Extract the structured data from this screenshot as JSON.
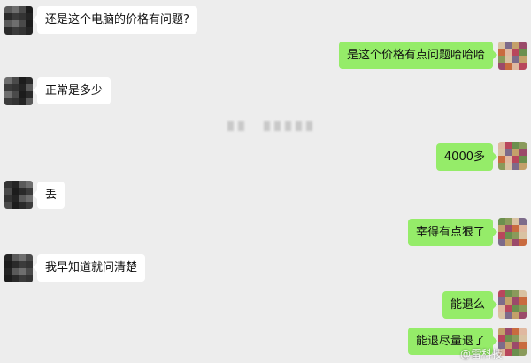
{
  "messages": [
    {
      "side": "in",
      "text": "还是这个电脑的价格有问题?"
    },
    {
      "side": "out",
      "text": "是这个价格有点问题哈哈哈"
    },
    {
      "side": "in",
      "text": "正常是多少"
    },
    {
      "side": "out",
      "text": "4000多"
    },
    {
      "side": "in",
      "text": "丢"
    },
    {
      "side": "out",
      "text": "宰得有点狠了"
    },
    {
      "side": "in",
      "text": "我早知道就问清楚"
    },
    {
      "side": "out",
      "text": "能退么"
    },
    {
      "side": "out",
      "text": "能退尽量退了"
    }
  ],
  "watermark": {
    "text": "@雷科技"
  },
  "colors": {
    "background": "#ededed",
    "incoming_bubble": "#ffffff",
    "outgoing_bubble": "#95ec69"
  },
  "avatars": {
    "contact": "pixelated-dark-avatar",
    "self": "pixelated-colorful-avatar"
  }
}
